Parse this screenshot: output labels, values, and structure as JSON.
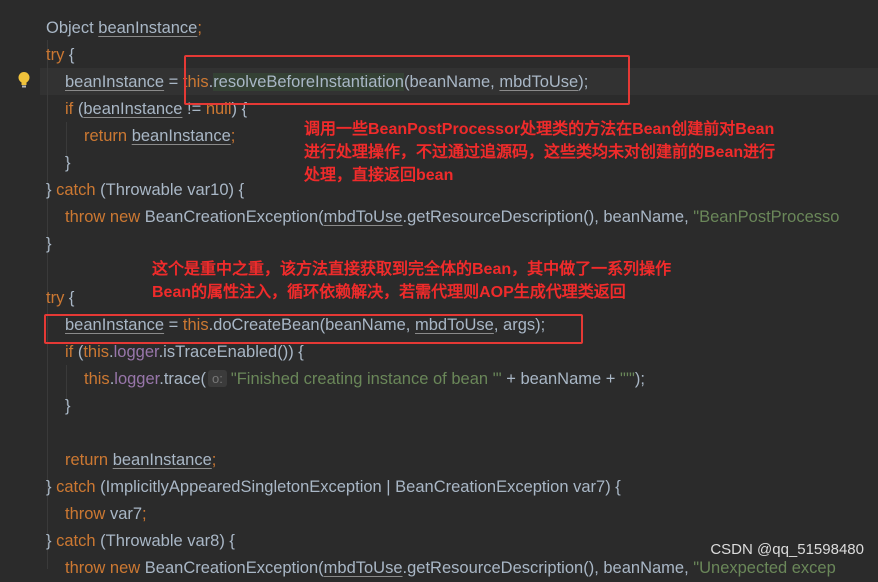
{
  "editor": {
    "lines": [
      {
        "id": "l1",
        "tokens": [
          {
            "t": "Object ",
            "c": "fn"
          },
          {
            "t": "beanInstance",
            "c": "fn u"
          },
          {
            "t": ";",
            "c": "kw"
          }
        ]
      },
      {
        "id": "l2",
        "tokens": [
          {
            "t": "try ",
            "c": "kw"
          },
          {
            "t": "{",
            "c": "fn"
          }
        ]
      },
      {
        "id": "l3",
        "tokens": [
          {
            "t": "beanInstance",
            "c": "fn u"
          },
          {
            "t": " = ",
            "c": "fn"
          },
          {
            "t": "this",
            "c": "kw"
          },
          {
            "t": ".",
            "c": "fn"
          },
          {
            "t": "resolveBeforeInstantiation",
            "c": "fn sel"
          },
          {
            "t": "(beanName, ",
            "c": "fn"
          },
          {
            "t": "mbdToUse",
            "c": "fn u"
          },
          {
            "t": ");",
            "c": "fn"
          }
        ]
      },
      {
        "id": "l4",
        "tokens": [
          {
            "t": "if ",
            "c": "kw"
          },
          {
            "t": "(",
            "c": "fn"
          },
          {
            "t": "beanInstance",
            "c": "fn u"
          },
          {
            "t": " != ",
            "c": "fn"
          },
          {
            "t": "null",
            "c": "kw"
          },
          {
            "t": ") {",
            "c": "fn"
          }
        ]
      },
      {
        "id": "l5",
        "tokens": [
          {
            "t": "return ",
            "c": "kw"
          },
          {
            "t": "beanInstance",
            "c": "fn u"
          },
          {
            "t": ";",
            "c": "kw"
          }
        ]
      },
      {
        "id": "l6",
        "tokens": [
          {
            "t": "}",
            "c": "fn"
          }
        ]
      },
      {
        "id": "l7",
        "tokens": [
          {
            "t": "} ",
            "c": "fn"
          },
          {
            "t": "catch ",
            "c": "kw"
          },
          {
            "t": "(Throwable var10) {",
            "c": "fn"
          }
        ]
      },
      {
        "id": "l8",
        "tokens": [
          {
            "t": "throw new ",
            "c": "kw"
          },
          {
            "t": "BeanCreationException(",
            "c": "fn"
          },
          {
            "t": "mbdToUse",
            "c": "fn u"
          },
          {
            "t": ".getResourceDescription(), beanName, ",
            "c": "fn"
          },
          {
            "t": "\"BeanPostProcesso",
            "c": "str"
          }
        ]
      },
      {
        "id": "l9",
        "tokens": [
          {
            "t": "}",
            "c": "fn"
          }
        ]
      },
      {
        "id": "l10",
        "tokens": [
          {
            "t": "try ",
            "c": "kw"
          },
          {
            "t": "{",
            "c": "fn"
          }
        ]
      },
      {
        "id": "l11",
        "tokens": [
          {
            "t": "beanInstance",
            "c": "fn u"
          },
          {
            "t": " = ",
            "c": "fn"
          },
          {
            "t": "this",
            "c": "kw"
          },
          {
            "t": ".doCreateBean(beanName, ",
            "c": "fn"
          },
          {
            "t": "mbdToUse",
            "c": "fn u"
          },
          {
            "t": ", args);",
            "c": "fn"
          }
        ]
      },
      {
        "id": "l12",
        "tokens": [
          {
            "t": "if ",
            "c": "kw"
          },
          {
            "t": "(",
            "c": "fn"
          },
          {
            "t": "this",
            "c": "kw"
          },
          {
            "t": ".",
            "c": "fn"
          },
          {
            "t": "logger",
            "c": "fld"
          },
          {
            "t": ".isTraceEnabled()) {",
            "c": "fn"
          }
        ]
      },
      {
        "id": "l13",
        "tokens": [
          {
            "t": "this",
            "c": "kw"
          },
          {
            "t": ".",
            "c": "fn"
          },
          {
            "t": "logger",
            "c": "fld"
          },
          {
            "t": ".trace(",
            "c": "fn"
          },
          {
            "t": "o:",
            "c": "hint"
          },
          {
            "t": "\"Finished creating instance of bean '\"",
            "c": "str"
          },
          {
            "t": " + beanName + ",
            "c": "fn"
          },
          {
            "t": "\"'\"",
            "c": "str"
          },
          {
            "t": ");",
            "c": "fn"
          }
        ]
      },
      {
        "id": "l14",
        "tokens": [
          {
            "t": "}",
            "c": "fn"
          }
        ]
      },
      {
        "id": "l15",
        "tokens": [
          {
            "t": "return ",
            "c": "kw"
          },
          {
            "t": "beanInstance",
            "c": "fn u"
          },
          {
            "t": ";",
            "c": "kw"
          }
        ]
      },
      {
        "id": "l16",
        "tokens": [
          {
            "t": "} ",
            "c": "fn"
          },
          {
            "t": "catch ",
            "c": "kw"
          },
          {
            "t": "(ImplicitlyAppearedSingletonException | BeanCreationException var7) {",
            "c": "fn"
          }
        ]
      },
      {
        "id": "l17",
        "tokens": [
          {
            "t": "throw ",
            "c": "kw"
          },
          {
            "t": "var7",
            "c": "fn"
          },
          {
            "t": ";",
            "c": "kw"
          }
        ]
      },
      {
        "id": "l18",
        "tokens": [
          {
            "t": "} ",
            "c": "fn"
          },
          {
            "t": "catch ",
            "c": "kw"
          },
          {
            "t": "(Throwable var8) {",
            "c": "fn"
          }
        ]
      },
      {
        "id": "l19",
        "tokens": [
          {
            "t": "throw new ",
            "c": "kw"
          },
          {
            "t": "BeanCreationException(",
            "c": "fn"
          },
          {
            "t": "mbdToUse",
            "c": "fn u"
          },
          {
            "t": ".getResourceDescription(), beanName, ",
            "c": "fn"
          },
          {
            "t": "\"Unexpected excep",
            "c": "str"
          }
        ]
      }
    ]
  },
  "annotations": {
    "note1": "调用一些BeanPostProcessor处理类的方法在Bean创建前对Bean\n进行处理操作，不过通过追源码，这些类均未对创建前的Bean进行\n处理，直接返回bean",
    "note2": "这个是重中之重，该方法直接获取到完全体的Bean，其中做了一系列操作\nBean的属性注入，循环依赖解决，若需代理则AOP生成代理类返回"
  },
  "watermark": "CSDN @qq_51598480",
  "colors": {
    "keyword": "#cc7832",
    "text": "#a9b7c6",
    "string": "#6a8759",
    "field": "#9876aa",
    "annotation": "#f02b2b",
    "background": "#2b2b2b"
  }
}
